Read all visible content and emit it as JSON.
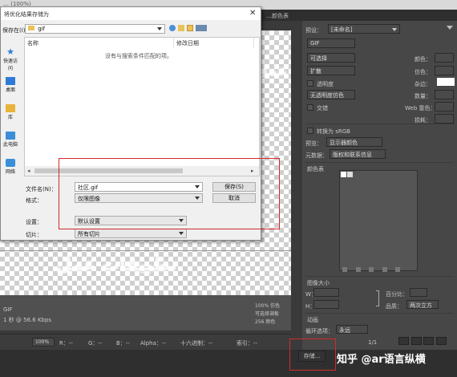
{
  "app": {
    "window_title": "… (100%)",
    "panel_tab": "…颜色表",
    "zoom": "100%"
  },
  "right_panel": {
    "preset_label": "预设：",
    "preset_value": "[未命名]",
    "format_value": "GIF",
    "reduction_value": "可选择",
    "dither_algo": "扩散",
    "transparency_label": "透明度",
    "matte_algo": "无透明度仿色",
    "interlace_label": "交错",
    "lossy_label": "损耗：",
    "colors_label": "颜色：",
    "dither_label": "仿色：",
    "matte_label": "杂边：",
    "amount_label": "数量：",
    "web_snap_label": "Web 靠色：",
    "convert_label": "转换为 sRGB",
    "preview_label": "预览：",
    "preview_value": "显示器颜色",
    "metadata_label": "元数据：",
    "metadata_value": "版权和联系信息",
    "color_table_label": "颜色表",
    "image_size_label": "图像大小",
    "width_label": "W：",
    "height_label": "H：",
    "percent_label": "百分比：",
    "quality_label": "品质：",
    "quality_value": "两次立方",
    "anim_label": "动画",
    "loop_label": "循环选项：",
    "loop_value": "永远",
    "frame_counter": "1/1",
    "store_button": "存储...",
    "watermark": "知乎 @ar语言纵横"
  },
  "status_bar": {
    "left_zoom": "100%",
    "r_label": "R：--",
    "g_label": "G：--",
    "b_label": "B：--",
    "alpha_label": "Alpha：--",
    "hex_label": "十六进制：--",
    "index_label": "索引：--",
    "info_left_1": "GIF",
    "info_left_2": "1 秒 @ 56.6 Kbps",
    "info_right_1": "100% 仿色",
    "info_right_2": "可选择调板",
    "info_right_3": "256 颜色"
  },
  "canvas": {
    "blurred_text_1": "عمل تطبيقات",
    "blurred_text_2": "تطبيقات عمل"
  },
  "dialog": {
    "title": "将优化结果存储为",
    "save_in_label": "保存在(I)：",
    "save_in_value": "gif",
    "nav_items": [
      "快速访问",
      "桌面",
      "库",
      "此电脑",
      "网络"
    ],
    "col_name": "名称",
    "col_modified": "修改日期",
    "empty_message": "没有与搜索条件匹配的项。",
    "filename_label": "文件名(N)：",
    "filename_value": "社区.gif",
    "format_label": "格式：",
    "format_value": "仅限图像",
    "save_button": "保存(S)",
    "cancel_button": "取消",
    "settings_label": "设置：",
    "settings_value": "默认设置",
    "slices_label": "切片：",
    "slices_value": "所有切片"
  }
}
